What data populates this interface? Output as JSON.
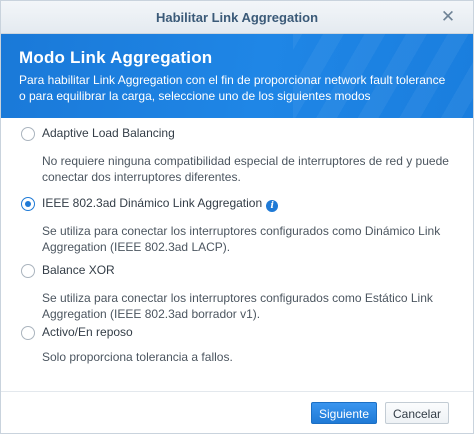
{
  "window": {
    "title": "Habilitar Link Aggregation",
    "close_icon": "close-icon"
  },
  "banner": {
    "heading": "Modo Link Aggregation",
    "description": "Para habilitar Link Aggregation con el fin de proporcionar network fault tolerance o para equilibrar la carga, seleccione uno de los siguientes modos"
  },
  "options": [
    {
      "label": "Adaptive Load Balancing",
      "description": "No requiere ninguna compatibilidad especial de interruptores de red y puede conectar dos interruptores diferentes.",
      "selected": false
    },
    {
      "label": "IEEE 802.3ad Dinámico Link Aggregation",
      "info_icon": "info-icon",
      "description": "Se utiliza para conectar los interruptores configurados como Dinámico Link Aggregation (IEEE 802.3ad LACP).",
      "selected": true
    },
    {
      "label": "Balance XOR",
      "description": "Se utiliza para conectar los interruptores configurados como Estático Link Aggregation (IEEE 802.3ad borrador v1).",
      "selected": false
    },
    {
      "label": "Activo/En reposo",
      "description": "Solo proporciona tolerancia a fallos.",
      "selected": false
    }
  ],
  "footer": {
    "next_label": "Siguiente",
    "cancel_label": "Cancelar"
  },
  "colors": {
    "accent": "#1f7ad6",
    "banner": "#1a7ede",
    "title_text": "#3b5a78"
  }
}
